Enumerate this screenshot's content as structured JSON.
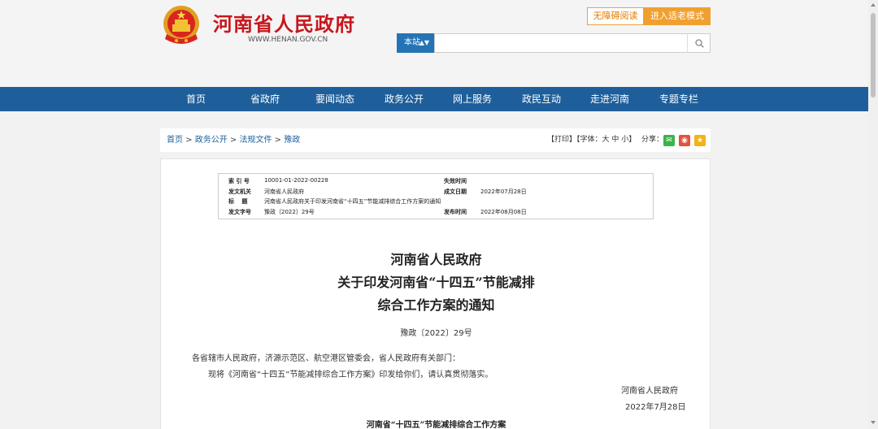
{
  "header": {
    "site_title": "河南省人民政府",
    "site_url": "WWW.HENAN.GOV.CN",
    "accessibility_label": "无障碍阅读",
    "elder_mode_label": "进入适老模式",
    "search_scope": "本站",
    "search_placeholder": ""
  },
  "nav": {
    "items": [
      "首页",
      "省政府",
      "要闻动态",
      "政务公开",
      "网上服务",
      "政民互动",
      "走进河南",
      "专题专栏"
    ]
  },
  "breadcrumb": {
    "items": [
      "首页",
      "政务公开",
      "法规文件",
      "豫政"
    ],
    "separator": " > "
  },
  "tools": {
    "print": "【打印】",
    "font_size": "【字体：大 中 小】",
    "share": "分享："
  },
  "meta": {
    "index_no_label": "索 引 号",
    "index_no": "10001-01-2022-00228",
    "expiry_label": "失效时间",
    "expiry": "",
    "issuer_label": "发文机关",
    "issuer": "河南省人民政府",
    "written_date_label": "成文日期",
    "written_date": "2022年07月28日",
    "title_label": "标　 题",
    "title": "河南省人民政府关于印发河南省“十四五”节能减排综合工作方案的通知",
    "doc_no_label": "发文字号",
    "doc_no": "豫政〔2022〕29号",
    "publish_date_label": "发布时间",
    "publish_date": "2022年08月08日"
  },
  "document": {
    "title_line1": "河南省人民政府",
    "title_line2": "关于印发河南省“十四五”节能减排",
    "title_line3": "综合工作方案的通知",
    "doc_number": "豫政〔2022〕29号",
    "addressee": "各省辖市人民政府，济源示范区、航空港区管委会，省人民政府有关部门：",
    "body": "现将《河南省“十四五”节能减排综合工作方案》印发给你们，请认真贯彻落实。",
    "signature": "河南省人民政府",
    "date": "2022年7月28日",
    "attachment_title": "河南省“十四五”节能减排综合工作方案"
  }
}
